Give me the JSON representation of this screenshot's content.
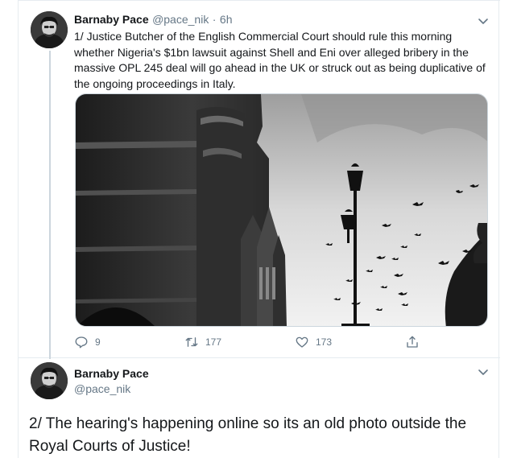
{
  "tweets": [
    {
      "author": "Barnaby Pace",
      "handle": "@pace_nik",
      "separator": "·",
      "time": "6h",
      "text": "1/ Justice Butcher of the English Commercial Court should rule this morning whether Nigeria's $1bn lawsuit against Shell and Eni over alleged bribery in the massive OPL 245 deal will go ahead in the UK or struck out as being duplicative of the ongoing proceedings in Italy.",
      "media_icon": "photo-of-royal-courts-of-justice-with-lamppost-and-birds",
      "actions": {
        "replies": "9",
        "retweets": "177",
        "likes": "173"
      }
    },
    {
      "author": "Barnaby Pace",
      "handle": "@pace_nik",
      "text": "2/ The hearing's happening online so its an old photo outside the Royal Courts of Justice!"
    }
  ],
  "colors": {
    "muted": "#657786",
    "border": "#e6ecf0",
    "thread": "#ccd6dd",
    "text": "#14171a"
  }
}
